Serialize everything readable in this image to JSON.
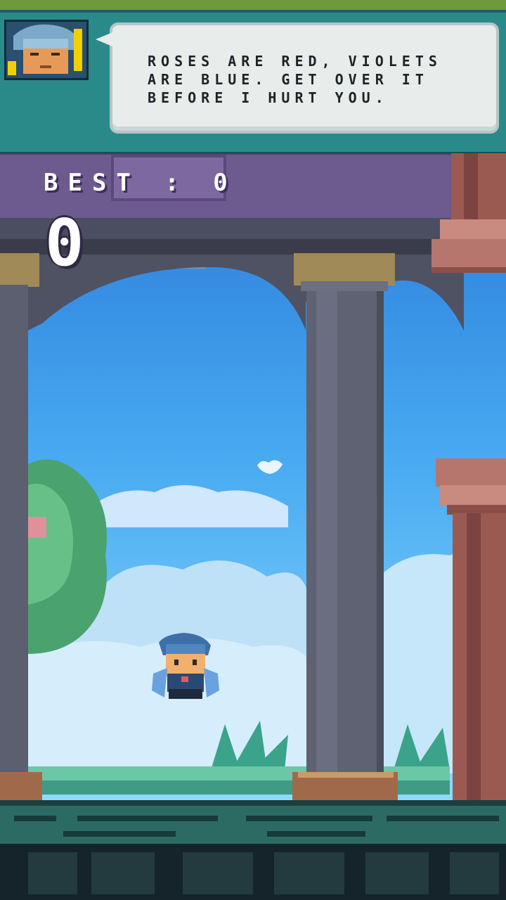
{
  "dialogue": {
    "text": "ROSES ARE RED, VIOLETS ARE BLUE. GET OVER IT BEFORE I HURT YOU."
  },
  "score": {
    "best_label": "BEST : 0",
    "current": "0"
  },
  "colors": {
    "sky_top": "#2f8be0",
    "sky_bottom": "#7fd2ff",
    "stone": "#5b5f6e",
    "pillar": "#5f6272",
    "ground": "#2c6b64",
    "pipe": "#b7766d",
    "dialog": "#2a8a8a"
  }
}
